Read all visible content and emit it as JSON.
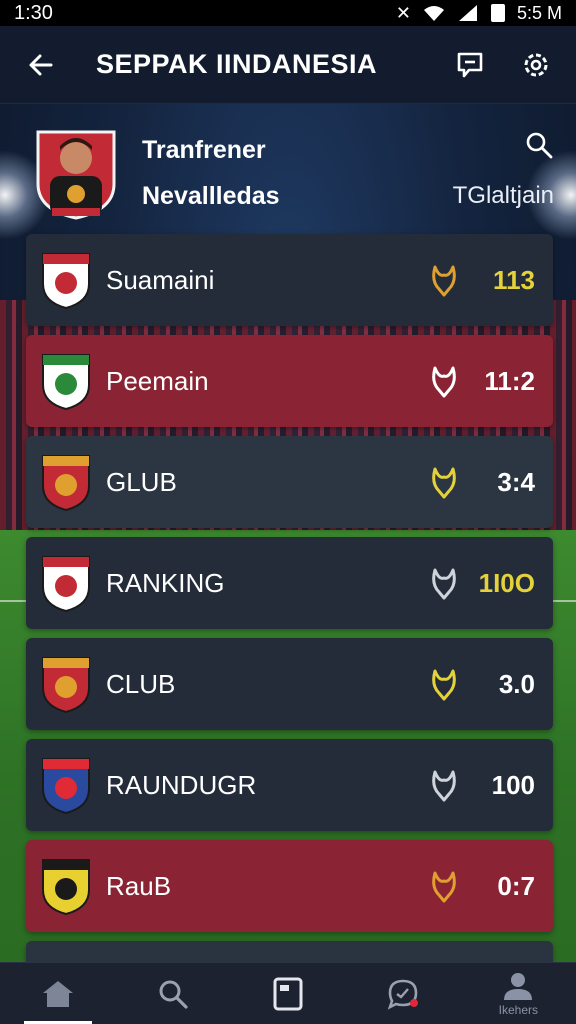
{
  "status_bar": {
    "time_left": "1:30",
    "time_right": "5:5 M"
  },
  "app_bar": {
    "title": "SEPPAK IINDANESIA"
  },
  "header": {
    "line1": "Tranfrener",
    "line2": "Nevallledas",
    "tag": "TGlaltjain"
  },
  "rows": [
    {
      "label": "Suamaini",
      "value": "113",
      "value_color": "#e3d23a",
      "icon_color": "#e0a030",
      "bg": "dark"
    },
    {
      "label": "Peemain",
      "value": "11:2",
      "value_color": "#ffffff",
      "icon_color": "#ffffff",
      "bg": "red"
    },
    {
      "label": "GLUB",
      "value": "3:4",
      "value_color": "#ffffff",
      "icon_color": "#e3d23a",
      "bg": "alt"
    },
    {
      "label": "RANKING",
      "value": "1I0O",
      "value_color": "#e3d23a",
      "icon_color": "#cfd3da",
      "bg": "dark"
    },
    {
      "label": "CLUB",
      "value": "3.0",
      "value_color": "#ffffff",
      "icon_color": "#e3d23a",
      "bg": "dark"
    },
    {
      "label": "RAUNDUGR",
      "value": "100",
      "value_color": "#ffffff",
      "icon_color": "#cfd3da",
      "bg": "dark"
    },
    {
      "label": "RauB",
      "value": "0:7",
      "value_color": "#ffffff",
      "icon_color": "#e0a030",
      "bg": "red"
    }
  ],
  "bottom_nav": {
    "items": [
      {
        "icon": "home-icon",
        "caption": ""
      },
      {
        "icon": "search-icon",
        "caption": ""
      },
      {
        "icon": "card-icon",
        "caption": ""
      },
      {
        "icon": "chat-icon",
        "caption": ""
      },
      {
        "icon": "profile-icon",
        "caption": "Ikehers"
      }
    ]
  },
  "colors": {
    "accent_red": "#8a2333",
    "row_dark": "#242c3a",
    "appbar": "#121c2e"
  }
}
